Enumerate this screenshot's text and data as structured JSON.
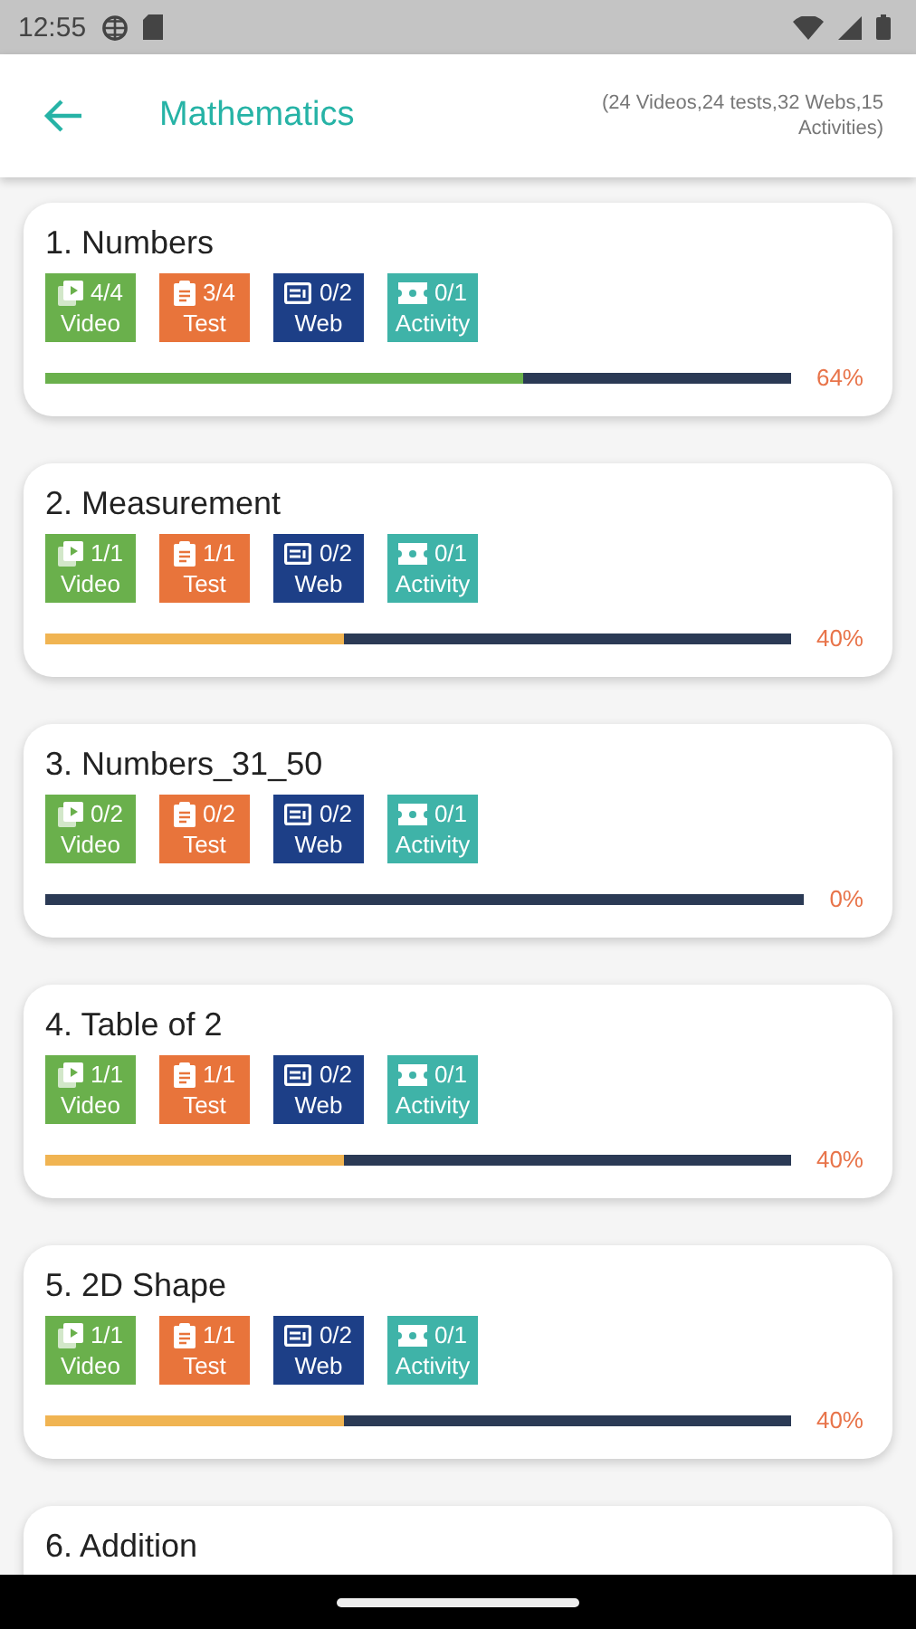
{
  "status_bar": {
    "time": "12:55"
  },
  "header": {
    "title": "Mathematics",
    "summary": "(24 Videos,24 tests,32 Webs,15 Activities)"
  },
  "topics": [
    {
      "title": "1. Numbers",
      "tiles": [
        {
          "kind": "video",
          "count": "4/4",
          "label": "Video"
        },
        {
          "kind": "test",
          "count": "3/4",
          "label": "Test"
        },
        {
          "kind": "web",
          "count": "0/2",
          "label": "Web"
        },
        {
          "kind": "activity",
          "count": "0/1",
          "label": "Activity"
        }
      ],
      "progress": {
        "level": 0.64,
        "color": "#6ab04c",
        "reading": "64%"
      }
    },
    {
      "title": "2. Measurement",
      "tiles": [
        {
          "kind": "video",
          "count": "1/1",
          "label": "Video"
        },
        {
          "kind": "test",
          "count": "1/1",
          "label": "Test"
        },
        {
          "kind": "web",
          "count": "0/2",
          "label": "Web"
        },
        {
          "kind": "activity",
          "count": "0/1",
          "label": "Activity"
        }
      ],
      "progress": {
        "level": 0.4,
        "color": "#f0b452",
        "reading": "40%"
      }
    },
    {
      "title": "3. Numbers_31_50",
      "tiles": [
        {
          "kind": "video",
          "count": "0/2",
          "label": "Video"
        },
        {
          "kind": "test",
          "count": "0/2",
          "label": "Test"
        },
        {
          "kind": "web",
          "count": "0/2",
          "label": "Web"
        },
        {
          "kind": "activity",
          "count": "0/1",
          "label": "Activity"
        }
      ],
      "progress": {
        "level": 0,
        "reading": "0%"
      }
    },
    {
      "title": "4. Table of 2",
      "tiles": [
        {
          "kind": "video",
          "count": "1/1",
          "label": "Video"
        },
        {
          "kind": "test",
          "count": "1/1",
          "label": "Test"
        },
        {
          "kind": "web",
          "count": "0/2",
          "label": "Web"
        },
        {
          "kind": "activity",
          "count": "0/1",
          "label": "Activity"
        }
      ],
      "progress": {
        "level": 0.4,
        "color": "#f0b452",
        "reading": "40%"
      }
    },
    {
      "title": "5. 2D Shape",
      "tiles": [
        {
          "kind": "video",
          "count": "1/1",
          "label": "Video"
        },
        {
          "kind": "test",
          "count": "1/1",
          "label": "Test"
        },
        {
          "kind": "web",
          "count": "0/2",
          "label": "Web"
        },
        {
          "kind": "activity",
          "count": "0/1",
          "label": "Activity"
        }
      ],
      "progress": {
        "level": 0.4,
        "color": "#f0b452",
        "reading": "40%"
      }
    },
    {
      "title": "6. Addition"
    }
  ]
}
